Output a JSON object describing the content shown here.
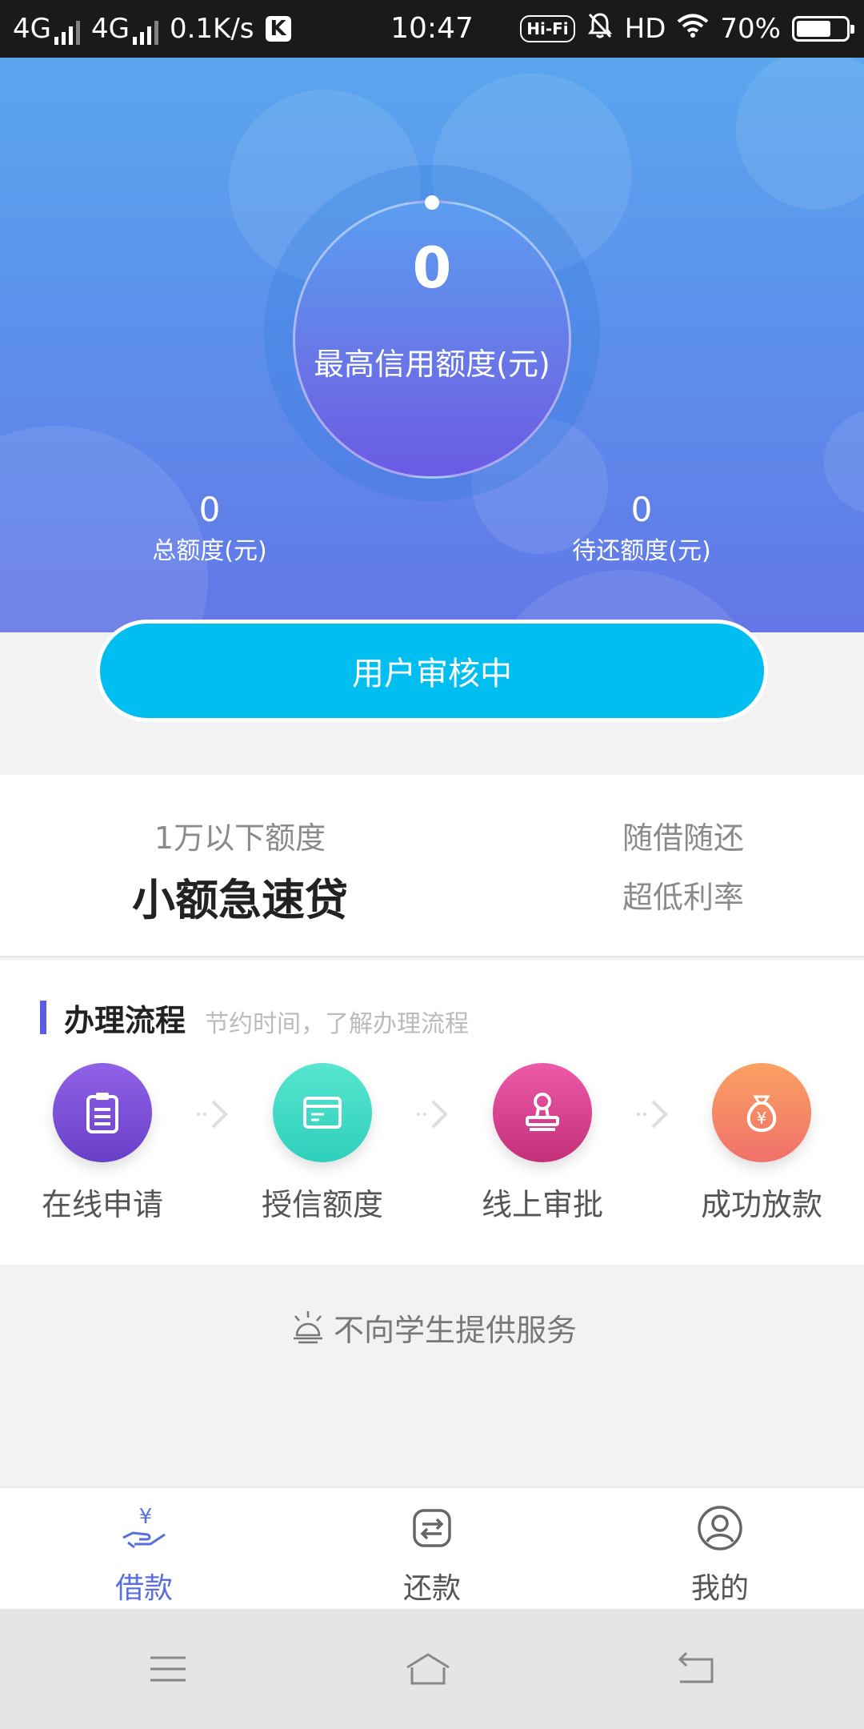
{
  "status_bar": {
    "network1": "4G",
    "network2": "4G",
    "speed": "0.1K/s",
    "app_badge": "K",
    "time": "10:47",
    "hifi": "Hi-Fi",
    "hd": "HD",
    "battery": "70%",
    "battery_level": 0.7
  },
  "hero": {
    "max_value": "0",
    "max_label": "最高信用额度(元)",
    "total_value": "0",
    "total_label": "总额度(元)",
    "pending_value": "0",
    "pending_label": "待还额度(元)"
  },
  "status_button": "用户审核中",
  "product": {
    "subtitle": "1万以下额度",
    "name": "小额急速贷",
    "feature1": "随借随还",
    "feature2": "超低利率"
  },
  "process": {
    "title": "办理流程",
    "hint": "节约时间，了解办理流程",
    "steps": [
      {
        "label": "在线申请",
        "icon": "clipboard-icon",
        "color": "#7b52d6"
      },
      {
        "label": "授信额度",
        "icon": "card-icon",
        "color": "#3fd9c4"
      },
      {
        "label": "线上审批",
        "icon": "stamp-icon",
        "color": "#d9408f"
      },
      {
        "label": "成功放款",
        "icon": "money-bag-icon",
        "color": "#f48a5a"
      }
    ]
  },
  "notice": "不向学生提供服务",
  "tabs": [
    {
      "label": "借款",
      "icon": "loan-icon",
      "active": true
    },
    {
      "label": "还款",
      "icon": "repay-icon",
      "active": false
    },
    {
      "label": "我的",
      "icon": "profile-icon",
      "active": false
    }
  ],
  "colors": {
    "accent": "#5b6ee0",
    "button": "#00bff0"
  }
}
